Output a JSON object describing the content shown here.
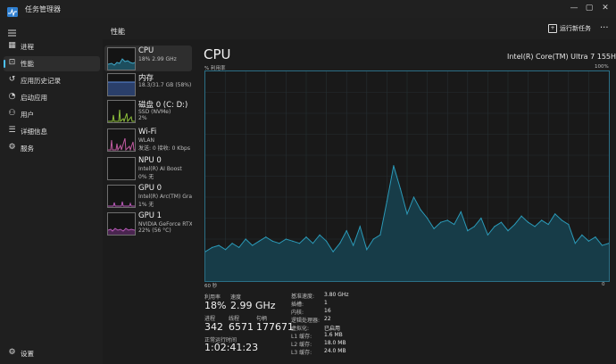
{
  "window": {
    "title": "任务管理器",
    "controls": [
      "—",
      "▢",
      "✕"
    ]
  },
  "nav": {
    "menu_icon": "hamburger-icon",
    "items": [
      {
        "label": "进程",
        "icon": "processes-icon"
      },
      {
        "label": "性能",
        "icon": "performance-icon",
        "active": true
      },
      {
        "label": "应用历史记录",
        "icon": "history-icon"
      },
      {
        "label": "启动应用",
        "icon": "startup-icon"
      },
      {
        "label": "用户",
        "icon": "users-icon"
      },
      {
        "label": "详细信息",
        "icon": "details-icon"
      },
      {
        "label": "服务",
        "icon": "services-icon"
      }
    ],
    "settings_label": "设置"
  },
  "header": {
    "title": "性能",
    "new_task_label": "运行新任务",
    "more_label": "···"
  },
  "resources": [
    {
      "name": "CPU",
      "line1": "18% 2.99 GHz",
      "line2": "",
      "color": "#3fa6c6",
      "active": true
    },
    {
      "name": "内存",
      "line1": "18.3/31.7 GB (58%)",
      "line2": "",
      "color": "#5b8ad8"
    },
    {
      "name": "磁盘 0 (C: D:)",
      "line1": "SSD (NVMe)",
      "line2": "2%",
      "color": "#8dbf3a"
    },
    {
      "name": "Wi-Fi",
      "line1": "WLAN",
      "line2": "发送: 0 接收: 0 Kbps",
      "color": "#c05aa0"
    },
    {
      "name": "NPU 0",
      "line1": "Intel(R) AI Boost",
      "line2": "0% 无",
      "color": "#3fa6c6"
    },
    {
      "name": "GPU 0",
      "line1": "Intel(R) Arc(TM) Grap.",
      "line2": "1% 无",
      "color": "#b85ab8"
    },
    {
      "name": "GPU 1",
      "line1": "NVIDIA GeForce RTX .",
      "line2": "22% (56 °C)",
      "color": "#b85ab8"
    }
  ],
  "main": {
    "title": "CPU",
    "model": "Intel(R) Core(TM) Ultra 7 155H",
    "y_label": "% 利用率",
    "y_max": "100%",
    "x_left": "60 秒",
    "x_right": "0",
    "graph_line_color": "#2b9ab8",
    "graph_fill_color": "#173c48",
    "stats": {
      "utilization_label": "利用率",
      "utilization": "18%",
      "speed_label": "速度",
      "speed": "2.99 GHz",
      "processes_label": "进程",
      "processes": "342",
      "threads_label": "线程",
      "threads": "6571",
      "handles_label": "句柄",
      "handles": "177671",
      "uptime_label": "正常运行时间",
      "uptime": "1:02:41:23"
    },
    "details": [
      {
        "k": "基准速度:",
        "v": "3.80 GHz"
      },
      {
        "k": "插槽:",
        "v": "1"
      },
      {
        "k": "内核:",
        "v": "16"
      },
      {
        "k": "逻辑处理器:",
        "v": "22"
      },
      {
        "k": "虚拟化:",
        "v": "已启用"
      },
      {
        "k": "L1 缓存:",
        "v": "1.6 MB"
      },
      {
        "k": "L2 缓存:",
        "v": "18.0 MB"
      },
      {
        "k": "L3 缓存:",
        "v": "24.0 MB"
      }
    ]
  },
  "chart_data": {
    "type": "area",
    "xlabel": "60 秒",
    "ylabel": "% 利用率",
    "ylim": [
      0,
      100
    ],
    "x": [
      60,
      59,
      58,
      57,
      56,
      55,
      54,
      53,
      52,
      51,
      50,
      49,
      48,
      47,
      46,
      45,
      44,
      43,
      42,
      41,
      40,
      39,
      38,
      37,
      36,
      35,
      34,
      33,
      32,
      31,
      30,
      29,
      28,
      27,
      26,
      25,
      24,
      23,
      22,
      21,
      20,
      19,
      18,
      17,
      16,
      15,
      14,
      13,
      12,
      11,
      10,
      9,
      8,
      7,
      6,
      5,
      4,
      3,
      2,
      1,
      0
    ],
    "series": [
      {
        "values": [
          14,
          16,
          17,
          15,
          18,
          16,
          20,
          17,
          19,
          21,
          19,
          18,
          20,
          19,
          18,
          21,
          18,
          22,
          19,
          14,
          18,
          24,
          17,
          26,
          15,
          20,
          22,
          38,
          55,
          44,
          32,
          40,
          34,
          30,
          25,
          28,
          29,
          27,
          33,
          24,
          26,
          30,
          22,
          26,
          28,
          24,
          27,
          31,
          28,
          26,
          29,
          27,
          32,
          29,
          27,
          18,
          22,
          19,
          21,
          17,
          18
        ]
      }
    ]
  }
}
